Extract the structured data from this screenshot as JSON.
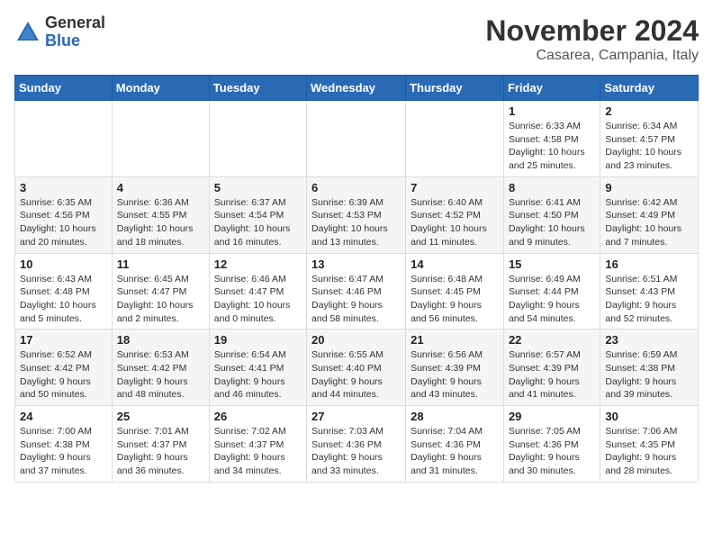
{
  "header": {
    "logo_line1": "General",
    "logo_line2": "Blue",
    "month_title": "November 2024",
    "subtitle": "Casarea, Campania, Italy"
  },
  "weekdays": [
    "Sunday",
    "Monday",
    "Tuesday",
    "Wednesday",
    "Thursday",
    "Friday",
    "Saturday"
  ],
  "weeks": [
    [
      {
        "day": "",
        "info": ""
      },
      {
        "day": "",
        "info": ""
      },
      {
        "day": "",
        "info": ""
      },
      {
        "day": "",
        "info": ""
      },
      {
        "day": "",
        "info": ""
      },
      {
        "day": "1",
        "info": "Sunrise: 6:33 AM\nSunset: 4:58 PM\nDaylight: 10 hours and 25 minutes."
      },
      {
        "day": "2",
        "info": "Sunrise: 6:34 AM\nSunset: 4:57 PM\nDaylight: 10 hours and 23 minutes."
      }
    ],
    [
      {
        "day": "3",
        "info": "Sunrise: 6:35 AM\nSunset: 4:56 PM\nDaylight: 10 hours and 20 minutes."
      },
      {
        "day": "4",
        "info": "Sunrise: 6:36 AM\nSunset: 4:55 PM\nDaylight: 10 hours and 18 minutes."
      },
      {
        "day": "5",
        "info": "Sunrise: 6:37 AM\nSunset: 4:54 PM\nDaylight: 10 hours and 16 minutes."
      },
      {
        "day": "6",
        "info": "Sunrise: 6:39 AM\nSunset: 4:53 PM\nDaylight: 10 hours and 13 minutes."
      },
      {
        "day": "7",
        "info": "Sunrise: 6:40 AM\nSunset: 4:52 PM\nDaylight: 10 hours and 11 minutes."
      },
      {
        "day": "8",
        "info": "Sunrise: 6:41 AM\nSunset: 4:50 PM\nDaylight: 10 hours and 9 minutes."
      },
      {
        "day": "9",
        "info": "Sunrise: 6:42 AM\nSunset: 4:49 PM\nDaylight: 10 hours and 7 minutes."
      }
    ],
    [
      {
        "day": "10",
        "info": "Sunrise: 6:43 AM\nSunset: 4:48 PM\nDaylight: 10 hours and 5 minutes."
      },
      {
        "day": "11",
        "info": "Sunrise: 6:45 AM\nSunset: 4:47 PM\nDaylight: 10 hours and 2 minutes."
      },
      {
        "day": "12",
        "info": "Sunrise: 6:46 AM\nSunset: 4:47 PM\nDaylight: 10 hours and 0 minutes."
      },
      {
        "day": "13",
        "info": "Sunrise: 6:47 AM\nSunset: 4:46 PM\nDaylight: 9 hours and 58 minutes."
      },
      {
        "day": "14",
        "info": "Sunrise: 6:48 AM\nSunset: 4:45 PM\nDaylight: 9 hours and 56 minutes."
      },
      {
        "day": "15",
        "info": "Sunrise: 6:49 AM\nSunset: 4:44 PM\nDaylight: 9 hours and 54 minutes."
      },
      {
        "day": "16",
        "info": "Sunrise: 6:51 AM\nSunset: 4:43 PM\nDaylight: 9 hours and 52 minutes."
      }
    ],
    [
      {
        "day": "17",
        "info": "Sunrise: 6:52 AM\nSunset: 4:42 PM\nDaylight: 9 hours and 50 minutes."
      },
      {
        "day": "18",
        "info": "Sunrise: 6:53 AM\nSunset: 4:42 PM\nDaylight: 9 hours and 48 minutes."
      },
      {
        "day": "19",
        "info": "Sunrise: 6:54 AM\nSunset: 4:41 PM\nDaylight: 9 hours and 46 minutes."
      },
      {
        "day": "20",
        "info": "Sunrise: 6:55 AM\nSunset: 4:40 PM\nDaylight: 9 hours and 44 minutes."
      },
      {
        "day": "21",
        "info": "Sunrise: 6:56 AM\nSunset: 4:39 PM\nDaylight: 9 hours and 43 minutes."
      },
      {
        "day": "22",
        "info": "Sunrise: 6:57 AM\nSunset: 4:39 PM\nDaylight: 9 hours and 41 minutes."
      },
      {
        "day": "23",
        "info": "Sunrise: 6:59 AM\nSunset: 4:38 PM\nDaylight: 9 hours and 39 minutes."
      }
    ],
    [
      {
        "day": "24",
        "info": "Sunrise: 7:00 AM\nSunset: 4:38 PM\nDaylight: 9 hours and 37 minutes."
      },
      {
        "day": "25",
        "info": "Sunrise: 7:01 AM\nSunset: 4:37 PM\nDaylight: 9 hours and 36 minutes."
      },
      {
        "day": "26",
        "info": "Sunrise: 7:02 AM\nSunset: 4:37 PM\nDaylight: 9 hours and 34 minutes."
      },
      {
        "day": "27",
        "info": "Sunrise: 7:03 AM\nSunset: 4:36 PM\nDaylight: 9 hours and 33 minutes."
      },
      {
        "day": "28",
        "info": "Sunrise: 7:04 AM\nSunset: 4:36 PM\nDaylight: 9 hours and 31 minutes."
      },
      {
        "day": "29",
        "info": "Sunrise: 7:05 AM\nSunset: 4:36 PM\nDaylight: 9 hours and 30 minutes."
      },
      {
        "day": "30",
        "info": "Sunrise: 7:06 AM\nSunset: 4:35 PM\nDaylight: 9 hours and 28 minutes."
      }
    ]
  ]
}
